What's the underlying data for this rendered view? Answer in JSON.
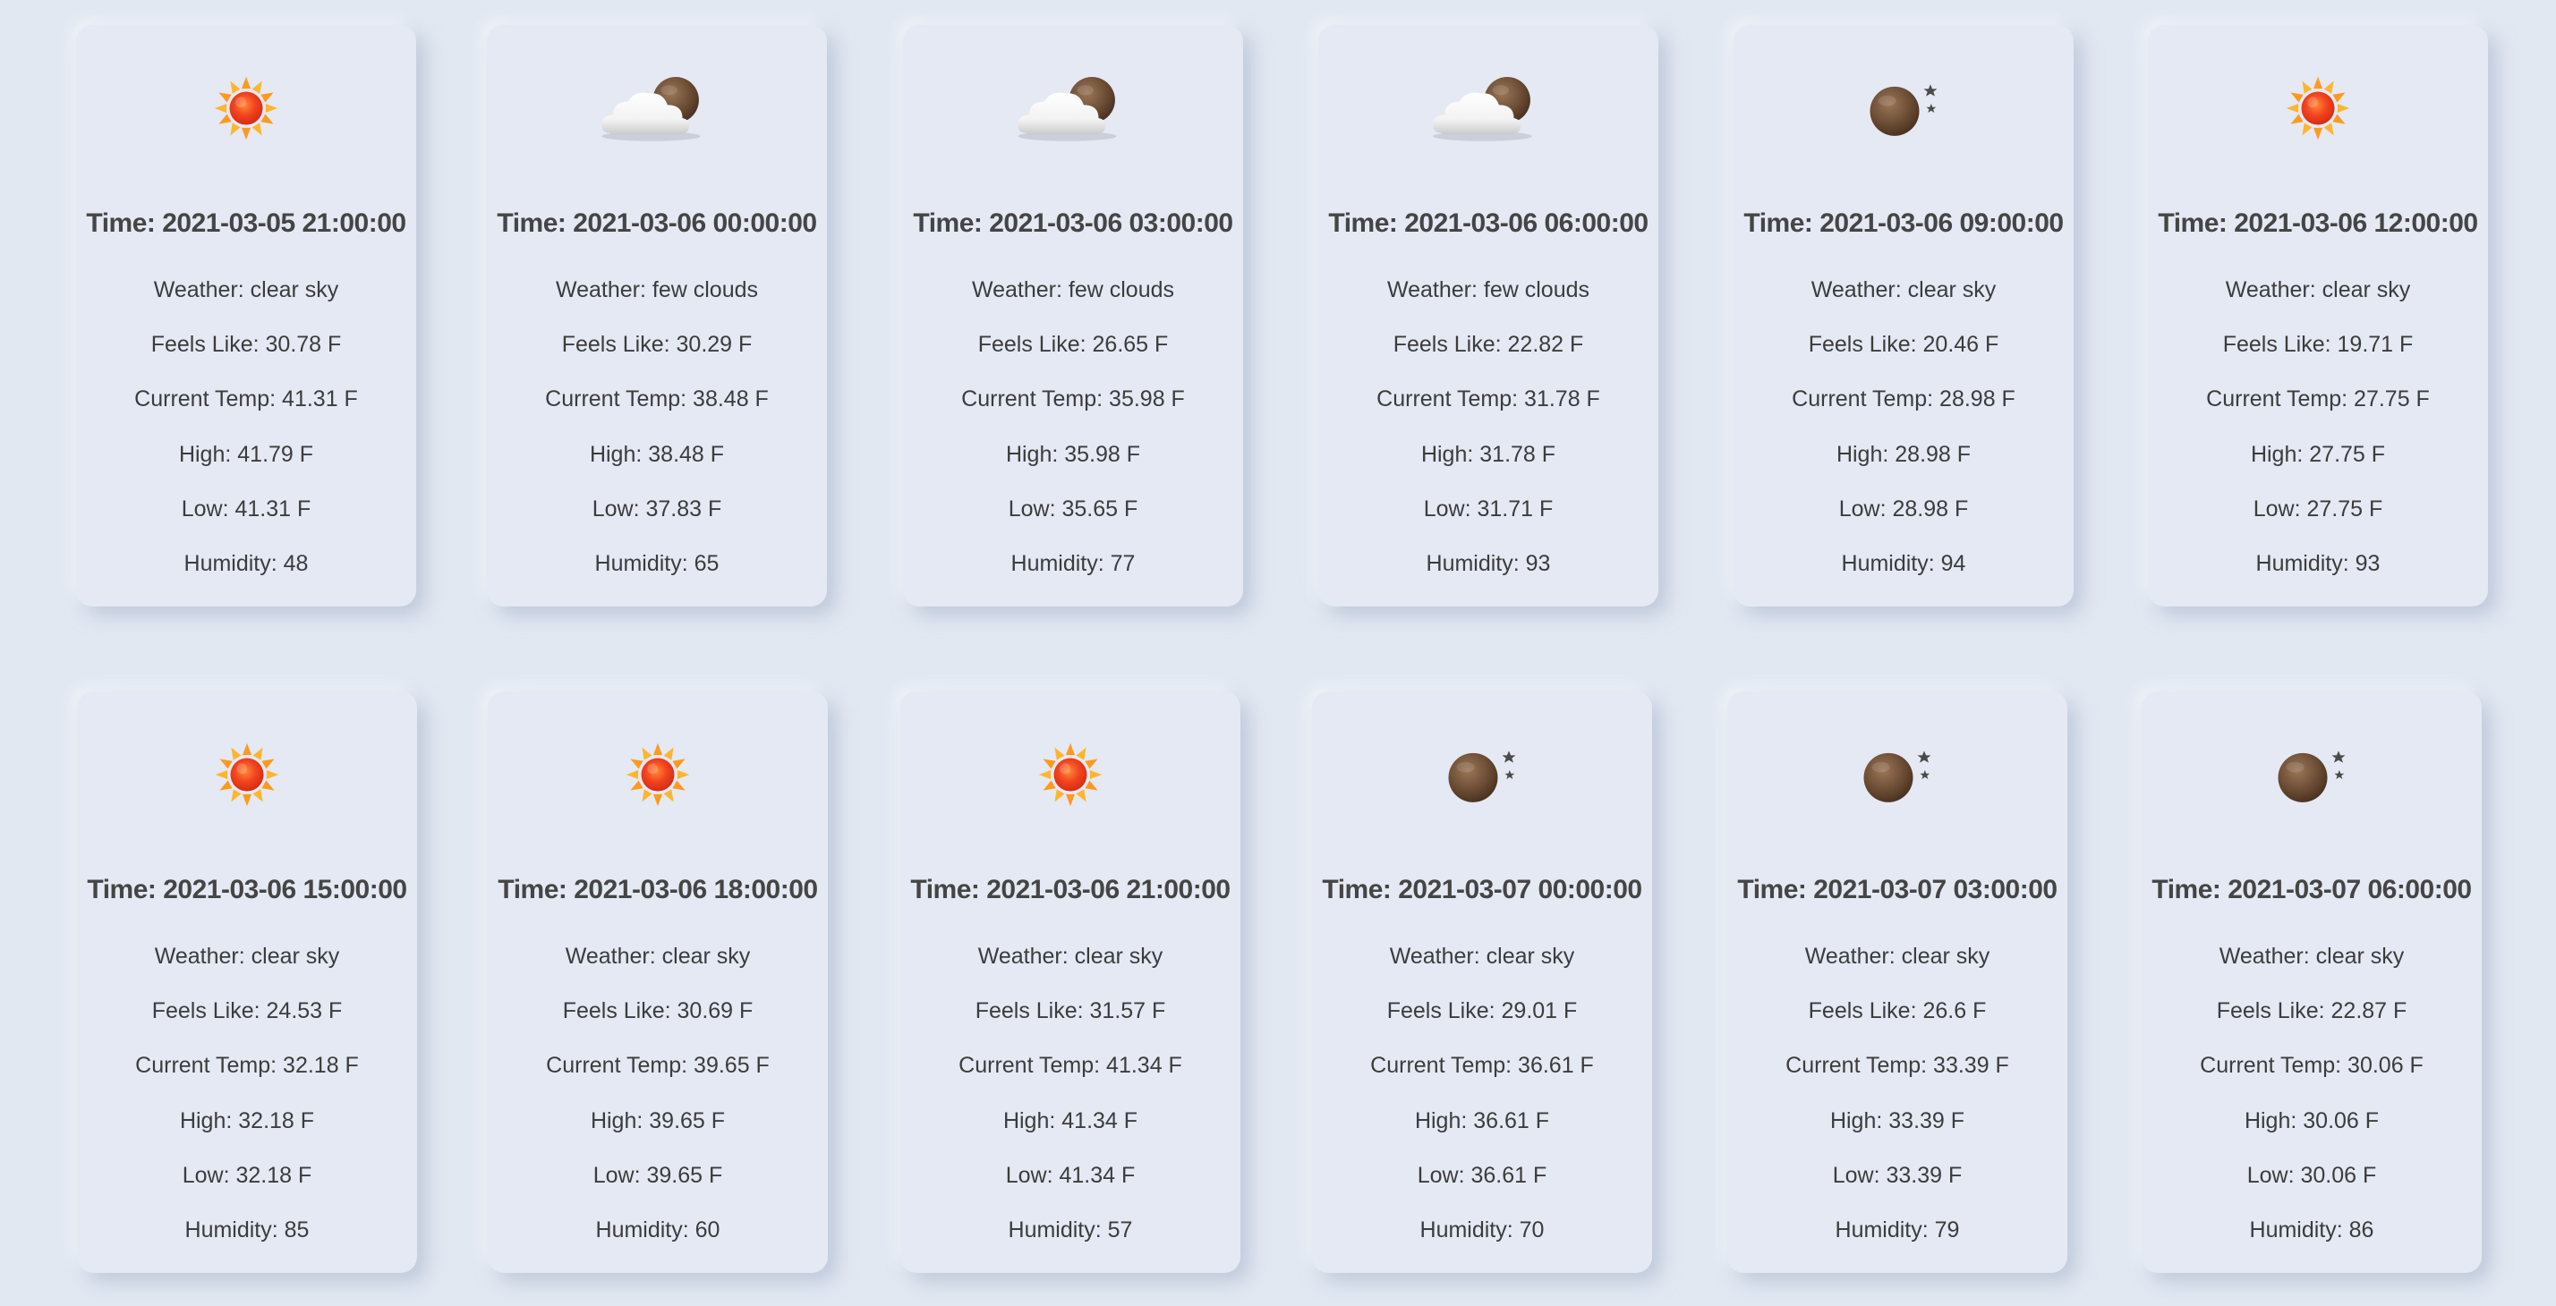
{
  "cards": [
    {
      "icon": "sun-icon",
      "time": "Time: 2021-03-05 21:00:00",
      "weather": "Weather: clear sky",
      "feels": "Feels Like: 30.78 F",
      "current": "Current Temp: 41.31 F",
      "high": "High: 41.79 F",
      "low": "Low: 41.31 F",
      "humidity": "Humidity: 48"
    },
    {
      "icon": "cloud-moon-icon",
      "time": "Time: 2021-03-06 00:00:00",
      "weather": "Weather: few clouds",
      "feels": "Feels Like: 30.29 F",
      "current": "Current Temp: 38.48 F",
      "high": "High: 38.48 F",
      "low": "Low: 37.83 F",
      "humidity": "Humidity: 65"
    },
    {
      "icon": "cloud-moon-icon",
      "time": "Time: 2021-03-06 03:00:00",
      "weather": "Weather: few clouds",
      "feels": "Feels Like: 26.65 F",
      "current": "Current Temp: 35.98 F",
      "high": "High: 35.98 F",
      "low": "Low: 35.65 F",
      "humidity": "Humidity: 77"
    },
    {
      "icon": "cloud-moon-icon",
      "time": "Time: 2021-03-06 06:00:00",
      "weather": "Weather: few clouds",
      "feels": "Feels Like: 22.82 F",
      "current": "Current Temp: 31.78 F",
      "high": "High: 31.78 F",
      "low": "Low: 31.71 F",
      "humidity": "Humidity: 93"
    },
    {
      "icon": "moon-stars-icon",
      "time": "Time: 2021-03-06 09:00:00",
      "weather": "Weather: clear sky",
      "feels": "Feels Like: 20.46 F",
      "current": "Current Temp: 28.98 F",
      "high": "High: 28.98 F",
      "low": "Low: 28.98 F",
      "humidity": "Humidity: 94"
    },
    {
      "icon": "sun-icon",
      "time": "Time: 2021-03-06 12:00:00",
      "weather": "Weather: clear sky",
      "feels": "Feels Like: 19.71 F",
      "current": "Current Temp: 27.75 F",
      "high": "High: 27.75 F",
      "low": "Low: 27.75 F",
      "humidity": "Humidity: 93"
    },
    {
      "icon": "sun-icon",
      "time": "Time: 2021-03-06 15:00:00",
      "weather": "Weather: clear sky",
      "feels": "Feels Like: 24.53 F",
      "current": "Current Temp: 32.18 F",
      "high": "High: 32.18 F",
      "low": "Low: 32.18 F",
      "humidity": "Humidity: 85"
    },
    {
      "icon": "sun-icon",
      "time": "Time: 2021-03-06 18:00:00",
      "weather": "Weather: clear sky",
      "feels": "Feels Like: 30.69 F",
      "current": "Current Temp: 39.65 F",
      "high": "High: 39.65 F",
      "low": "Low: 39.65 F",
      "humidity": "Humidity: 60"
    },
    {
      "icon": "sun-icon",
      "time": "Time: 2021-03-06 21:00:00",
      "weather": "Weather: clear sky",
      "feels": "Feels Like: 31.57 F",
      "current": "Current Temp: 41.34 F",
      "high": "High: 41.34 F",
      "low": "Low: 41.34 F",
      "humidity": "Humidity: 57"
    },
    {
      "icon": "moon-stars-icon",
      "time": "Time: 2021-03-07 00:00:00",
      "weather": "Weather: clear sky",
      "feels": "Feels Like: 29.01 F",
      "current": "Current Temp: 36.61 F",
      "high": "High: 36.61 F",
      "low": "Low: 36.61 F",
      "humidity": "Humidity: 70"
    },
    {
      "icon": "moon-stars-icon",
      "time": "Time: 2021-03-07 03:00:00",
      "weather": "Weather: clear sky",
      "feels": "Feels Like: 26.6 F",
      "current": "Current Temp: 33.39 F",
      "high": "High: 33.39 F",
      "low": "Low: 33.39 F",
      "humidity": "Humidity: 79"
    },
    {
      "icon": "moon-stars-icon",
      "time": "Time: 2021-03-07 06:00:00",
      "weather": "Weather: clear sky",
      "feels": "Feels Like: 22.87 F",
      "current": "Current Temp: 30.06 F",
      "high": "High: 30.06 F",
      "low": "Low: 30.06 F",
      "humidity": "Humidity: 86"
    }
  ]
}
